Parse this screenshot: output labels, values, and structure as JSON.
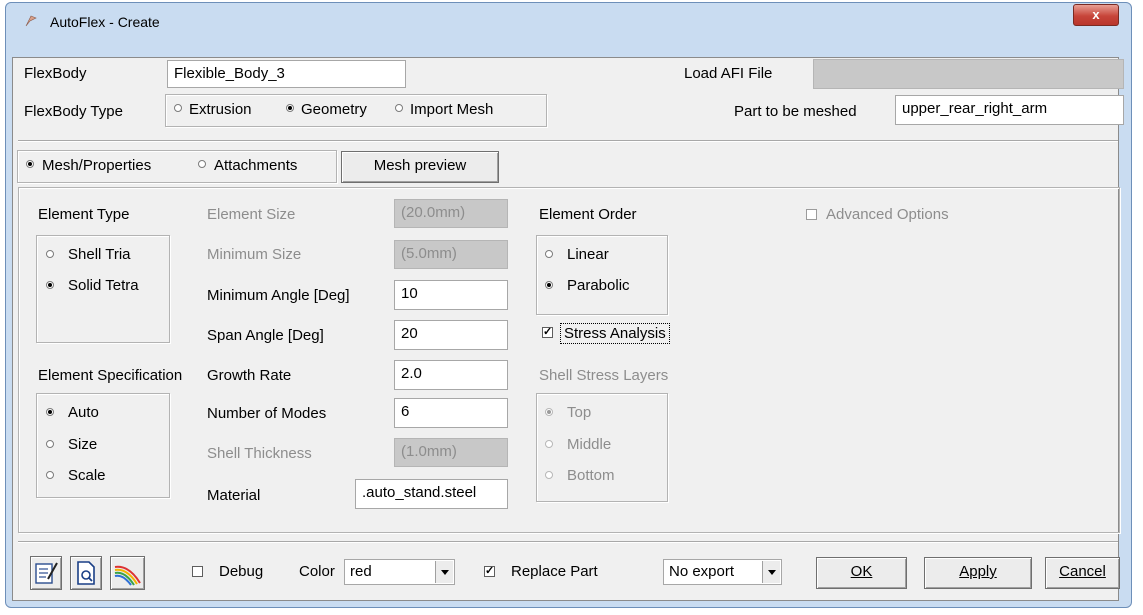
{
  "window": {
    "title": "AutoFlex - Create",
    "close_glyph": "x"
  },
  "header": {
    "flexbody_label": "FlexBody",
    "flexbody_value": "Flexible_Body_3",
    "load_afi_label": "Load AFI File",
    "load_afi_value": "",
    "type_label": "FlexBody Type",
    "type_options": [
      "Extrusion",
      "Geometry",
      "Import Mesh"
    ],
    "type_selected": "Geometry",
    "part_label": "Part to be meshed",
    "part_value": "upper_rear_right_arm"
  },
  "tabs": {
    "options": [
      "Mesh/Properties",
      "Attachments"
    ],
    "selected": "Mesh/Properties",
    "mesh_preview_label": "Mesh preview"
  },
  "element_type": {
    "label": "Element Type",
    "options": [
      "Shell Tria",
      "Solid Tetra"
    ],
    "selected": "Solid Tetra"
  },
  "mesh_params": {
    "element_size_label": "Element Size",
    "element_size_value": "(20.0mm)",
    "minimum_size_label": "Minimum Size",
    "minimum_size_value": "(5.0mm)",
    "min_angle_label": "Minimum Angle [Deg]",
    "min_angle_value": "10",
    "span_angle_label": "Span Angle [Deg]",
    "span_angle_value": "20",
    "growth_rate_label": "Growth Rate",
    "growth_rate_value": "2.0",
    "modes_label": "Number of Modes",
    "modes_value": "6",
    "shell_thickness_label": "Shell Thickness",
    "shell_thickness_value": "(1.0mm)",
    "material_label": "Material",
    "material_value": ".auto_stand.steel"
  },
  "element_order": {
    "label": "Element Order",
    "options": [
      "Linear",
      "Parabolic"
    ],
    "selected": "Parabolic",
    "stress_analysis_label": "Stress Analysis",
    "stress_analysis_checked": true
  },
  "advanced": {
    "label": "Advanced Options",
    "checked": false
  },
  "element_spec": {
    "label": "Element Specification",
    "options": [
      "Auto",
      "Size",
      "Scale"
    ],
    "selected": "Auto"
  },
  "shell_stress": {
    "label": "Shell Stress Layers",
    "options": [
      "Top",
      "Middle",
      "Bottom"
    ],
    "selected": "Top"
  },
  "footer": {
    "icons": [
      "edit-notes-icon",
      "document-search-icon",
      "rainbow-icon"
    ],
    "debug_label": "Debug",
    "debug_checked": false,
    "color_label": "Color",
    "color_value": "red",
    "replace_part_label": "Replace Part",
    "replace_part_checked": true,
    "export_value": "No export",
    "ok_label": "OK",
    "apply_label": "Apply",
    "cancel_label": "Cancel"
  },
  "check_glyph": "✓"
}
